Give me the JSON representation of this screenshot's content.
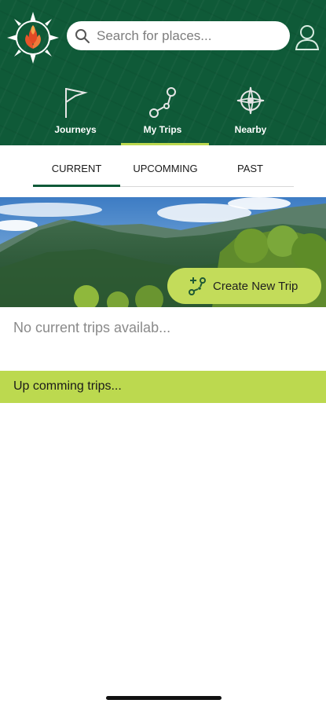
{
  "search": {
    "placeholder": "Search for places..."
  },
  "nav_tabs": [
    {
      "label": "Journeys",
      "icon": "flag-icon",
      "active": false
    },
    {
      "label": "My Trips",
      "icon": "route-icon",
      "active": true
    },
    {
      "label": "Nearby",
      "icon": "compass-icon",
      "active": false
    }
  ],
  "sub_tabs": [
    {
      "label": "CURRENT",
      "active": true
    },
    {
      "label": "UPCOMMING",
      "active": false
    },
    {
      "label": "PAST",
      "active": false
    }
  ],
  "hero": {
    "image": "mountain-landscape"
  },
  "create_button": {
    "label": "Create New Trip",
    "icon": "add-route-icon"
  },
  "current": {
    "empty_message": "No current trips availab..."
  },
  "upcoming": {
    "header": "Up comming trips..."
  },
  "colors": {
    "header_green": "#0f5a38",
    "accent_lime": "#bcd94f",
    "button_lime": "#c3dc5a",
    "logo_orange": "#e8552b"
  }
}
